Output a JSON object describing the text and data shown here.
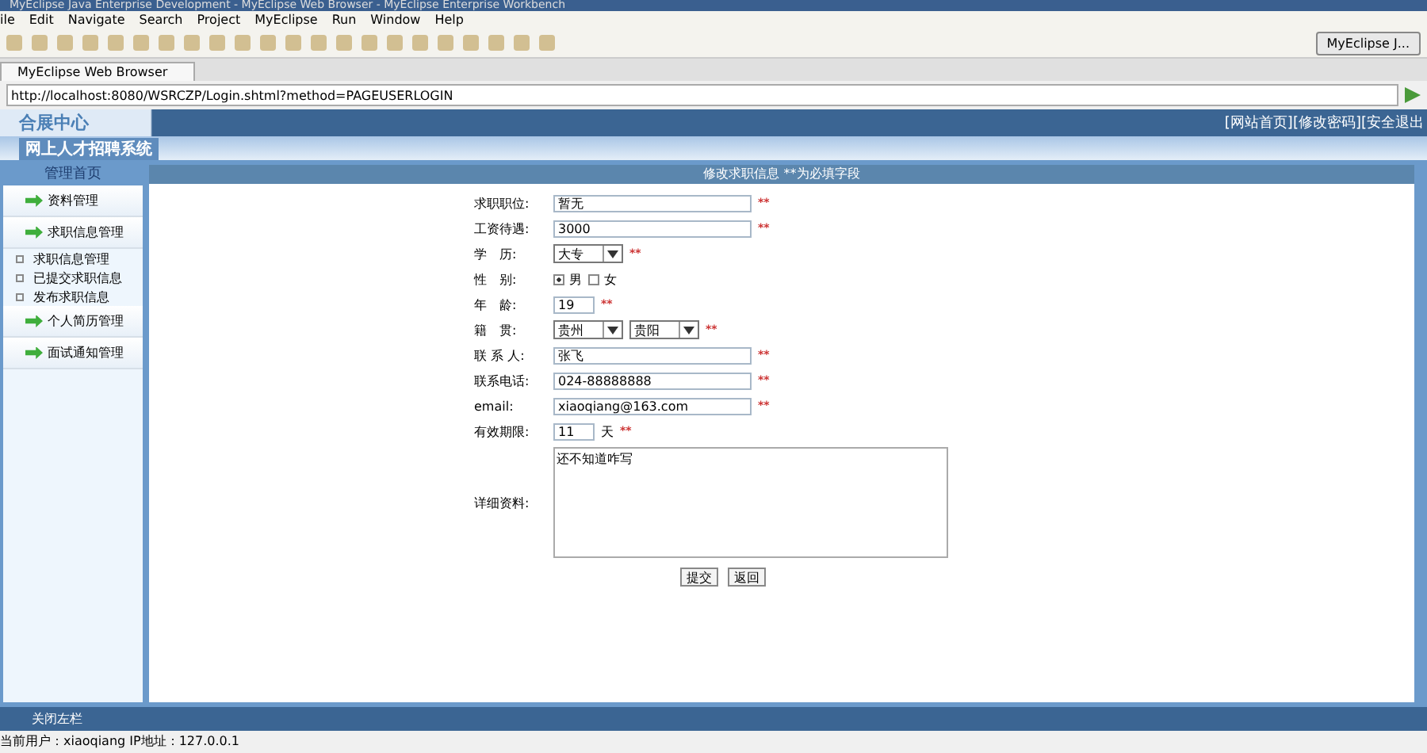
{
  "window": {
    "title": "MyEclipse Java Enterprise Development - MyEclipse Web Browser - MyEclipse Enterprise Workbench"
  },
  "menu": [
    "ile",
    "Edit",
    "Navigate",
    "Search",
    "Project",
    "MyEclipse",
    "Run",
    "Window",
    "Help"
  ],
  "perspective_button": "MyEclipse J...",
  "editor_tab": {
    "label": "MyEclipse Web Browser"
  },
  "address_bar": {
    "value": "http://localhost:8080/WSRCZP/Login.shtml?method=PAGEUSERLOGIN"
  },
  "page": {
    "logo": "合展中心",
    "subtitle": "网上人才招聘系统",
    "top_links": [
      "[网站首页]",
      "[修改密码]",
      "[安全退出"
    ],
    "sidebar": {
      "title": "管理首页",
      "items": [
        {
          "kind": "section",
          "label": "资料管理"
        },
        {
          "kind": "section",
          "label": "求职信息管理"
        },
        {
          "kind": "link",
          "label": "求职信息管理"
        },
        {
          "kind": "link",
          "label": "已提交求职信息"
        },
        {
          "kind": "link",
          "label": "发布求职信息"
        },
        {
          "kind": "section",
          "label": "个人简历管理"
        },
        {
          "kind": "section",
          "label": "面试通知管理"
        }
      ]
    },
    "form": {
      "header": "修改求职信息 **为必填字段",
      "fields": [
        {
          "kind": "text",
          "label": "求职职位:",
          "value": "暂无",
          "required": true
        },
        {
          "kind": "text",
          "label": "工资待遇:",
          "value": "3000",
          "required": true
        },
        {
          "kind": "select",
          "label": "学　历:",
          "options": [
            "大专"
          ],
          "required": true
        },
        {
          "kind": "radio",
          "label": "性　别:",
          "options": [
            {
              "label": "男",
              "selected": true
            },
            {
              "label": "女",
              "selected": false
            }
          ],
          "required": false
        },
        {
          "kind": "short_text",
          "label": "年　龄:",
          "value": "19",
          "required": true
        },
        {
          "kind": "select",
          "label": "籍　贯:",
          "options": [
            "贵州",
            "贵阳"
          ],
          "required": true
        },
        {
          "kind": "text",
          "label": "联 系 人:",
          "value": "张飞",
          "required": true
        },
        {
          "kind": "text",
          "label": "联系电话:",
          "value": "024-88888888",
          "required": true
        },
        {
          "kind": "text",
          "label": "email:",
          "value": "xiaoqiang@163.com",
          "required": true
        },
        {
          "kind": "short_text",
          "label": "有效期限:",
          "value": "11",
          "unit": "天",
          "required": true
        },
        {
          "kind": "textarea",
          "label": "详细资料:",
          "value": "还不知道咋写",
          "required": false
        }
      ],
      "required_mark": "**",
      "buttons": [
        "提交",
        "返回"
      ]
    },
    "footer_link": "关闭左栏",
    "status": "当前用户：xiaoqiang  IP地址：127.0.0.1"
  }
}
